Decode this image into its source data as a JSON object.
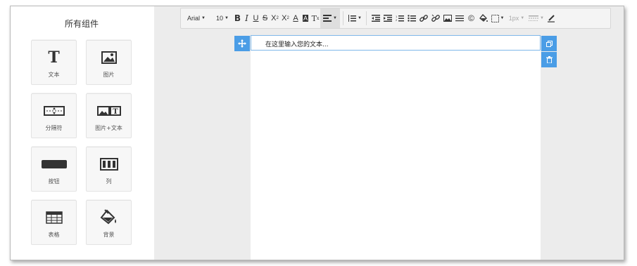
{
  "panel": {
    "title": "所有组件",
    "components": [
      {
        "label": "文本",
        "icon": "text-icon"
      },
      {
        "label": "图片",
        "icon": "image-icon"
      },
      {
        "label": "分隔符",
        "icon": "divider-icon"
      },
      {
        "label": "图片+文本",
        "icon": "image-text-icon"
      },
      {
        "label": "按钮",
        "icon": "button-icon"
      },
      {
        "label": "列",
        "icon": "columns-icon"
      },
      {
        "label": "表格",
        "icon": "table-icon"
      },
      {
        "label": "背景",
        "icon": "background-fill-icon"
      }
    ]
  },
  "toolbar": {
    "font_family": "Arial",
    "font_size": "10",
    "border_width": "1px",
    "items": [
      "bold-icon",
      "italic-icon",
      "underline-icon",
      "strikethrough-icon",
      "subscript-icon",
      "superscript-icon",
      "font-color-icon",
      "highlight-icon",
      "clear-format-icon",
      "align-icon",
      "line-height-icon",
      "outdent-icon",
      "indent-icon",
      "ordered-list-icon",
      "unordered-list-icon",
      "link-icon",
      "unlink-icon",
      "insert-image-icon",
      "horizontal-rule-icon",
      "copyright-icon",
      "fill-color-icon",
      "border-icon",
      "border-style-icon",
      "pen-icon"
    ]
  },
  "editor": {
    "placeholder": "在这里输入您的文本..."
  },
  "colors": {
    "accent": "#4a9de6",
    "canvas_bg": "#ececec",
    "selection_border": "#7fb7ea"
  }
}
